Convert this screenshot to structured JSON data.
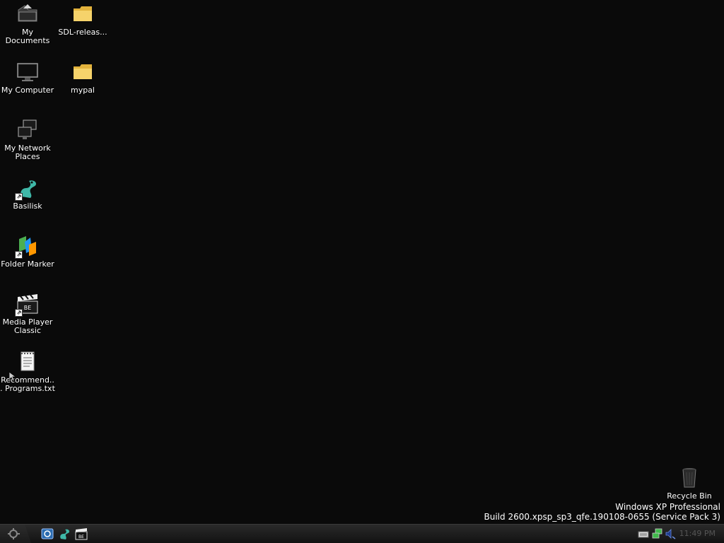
{
  "desktop": {
    "icons": [
      {
        "label": "My Documents",
        "icon": "my-documents-icon"
      },
      {
        "label": "SDL-releas...",
        "icon": "folder-icon"
      },
      {
        "label": "My Computer",
        "icon": "monitor-icon"
      },
      {
        "label": "mypal",
        "icon": "folder-icon"
      },
      {
        "label": "My Network Places",
        "icon": "network-icon"
      },
      {
        "label": "Basilisk",
        "icon": "basilisk-icon"
      },
      {
        "label": "Folder Marker",
        "icon": "folder-marker-icon"
      },
      {
        "label": "Media Player Classic",
        "icon": "media-player-icon"
      },
      {
        "label": "Recommend... Programs.txt",
        "icon": "text-file-icon"
      },
      {
        "label": "Recycle Bin",
        "icon": "recycle-bin-icon"
      }
    ],
    "watermark": {
      "line1": "Windows XP Professional",
      "line2": "Build 2600.xpsp_sp3_qfe.190108-0655 (Service Pack 3)"
    }
  },
  "taskbar": {
    "quick_launch": [
      {
        "icon": "show-desktop-icon"
      },
      {
        "icon": "basilisk-icon"
      },
      {
        "icon": "media-player-icon"
      }
    ],
    "tray": {
      "icons": [
        "keyboard-icon",
        "network-icon",
        "volume-icon"
      ],
      "clock": "11:49 PM"
    }
  },
  "colors": {
    "desktop_bg": "#0a0a0a",
    "taskbar_bg": "#1c1c1c",
    "text": "#ffffff",
    "folder_yellow": "#f2c94c"
  }
}
